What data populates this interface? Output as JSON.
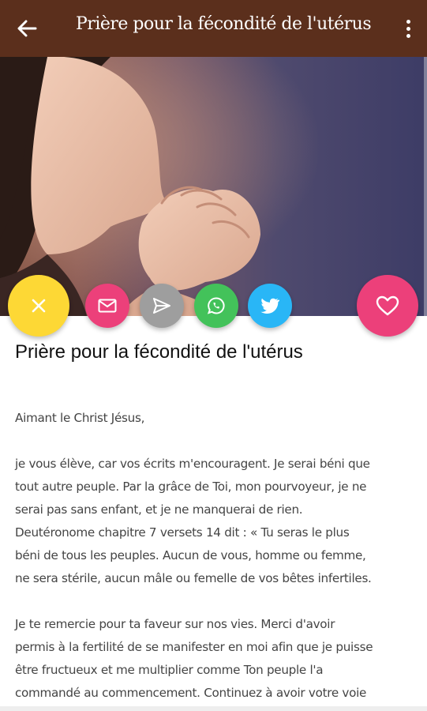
{
  "appbar": {
    "title": "Prière pour la fécondité de l'utérus",
    "back_icon": "arrow-left-icon",
    "more_icon": "more-vert-icon"
  },
  "hero": {
    "image": "woman-praying-photo"
  },
  "actions": {
    "close_icon": "close-icon",
    "mail_icon": "mail-icon",
    "send_icon": "send-icon",
    "whatsapp_icon": "whatsapp-icon",
    "twitter_icon": "twitter-icon",
    "favorite_icon": "heart-icon",
    "colors": {
      "close": "#fdd835",
      "mail": "#ec407a",
      "send": "#9e9e9e",
      "whatsapp": "#43c25a",
      "twitter": "#29b6f6",
      "favorite": "#ec407a"
    }
  },
  "article": {
    "title": "Prière pour la fécondité de l'utérus",
    "paragraphs": [
      [
        "Aimant le Christ Jésus,"
      ],
      [
        "je vous élève, car vos écrits m'encouragent. Je serai béni que",
        "tout autre peuple. Par la grâce de Toi, mon pourvoyeur, je ne",
        "serai pas sans enfant, et je ne manquerai de rien.",
        "Deutéronome chapitre 7 versets 14 dit : « Tu seras le plus",
        "béni de tous les peuples. Aucun de vous, homme ou femme,",
        "ne sera stérile, aucun mâle ou femelle de vos bêtes infertiles."
      ],
      [
        "Je te remercie pour ta faveur sur nos vies. Merci d'avoir",
        "permis à la fertilité de se manifester en moi afin que je puisse",
        "être fructueux et me multiplier comme Ton peuple l'a",
        "commandé au commencement. Continuez à avoir votre voie"
      ]
    ]
  },
  "theme": {
    "appbar": "#5b2f1c"
  }
}
